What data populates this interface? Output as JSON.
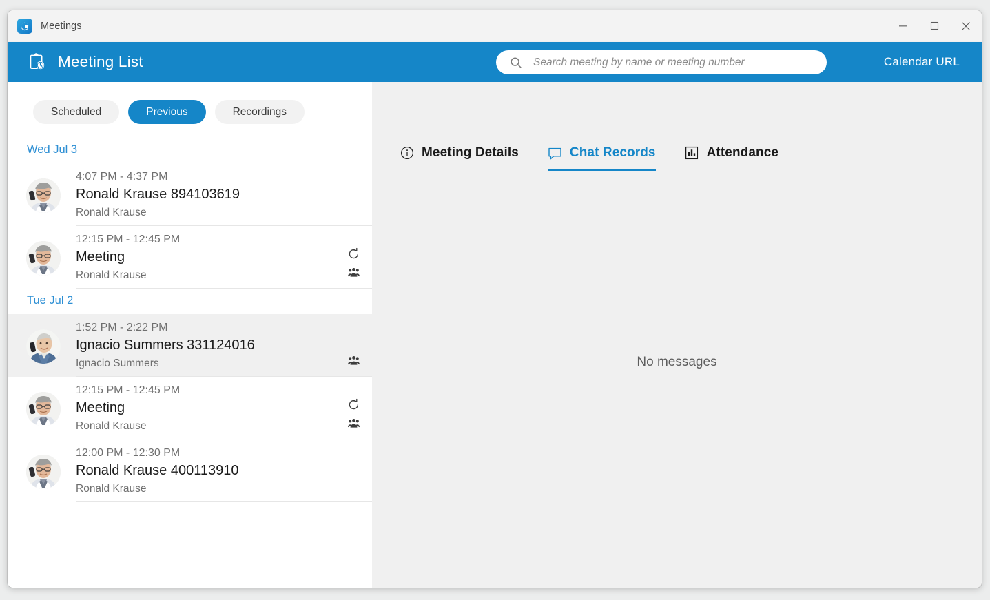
{
  "window": {
    "app_title": "Meetings",
    "logo_icon": "goto-g-logo-icon",
    "controls": {
      "minimize": "minimize-icon",
      "maximize": "maximize-icon",
      "close": "close-icon"
    }
  },
  "header": {
    "icon": "clipboard-clock-icon",
    "title": "Meeting List",
    "search": {
      "icon": "search-icon",
      "placeholder": "Search meeting by name or meeting number",
      "value": ""
    },
    "calendar_url_label": "Calendar URL",
    "background_color": "#1586c8"
  },
  "left_panel": {
    "filters": [
      {
        "label": "Scheduled",
        "active": false
      },
      {
        "label": "Previous",
        "active": true
      },
      {
        "label": "Recordings",
        "active": false
      }
    ],
    "groups": [
      {
        "day_label": "Wed Jul 3",
        "meetings": [
          {
            "time": "4:07 PM - 4:37 PM",
            "title": "Ronald Krause 894103619",
            "organizer": "Ronald Krause",
            "avatar": "man-on-phone-gray-hair",
            "selected": false,
            "recurring": false,
            "has_attendees": false
          },
          {
            "time": "12:15 PM - 12:45 PM",
            "title": "Meeting",
            "organizer": "Ronald Krause",
            "avatar": "man-on-phone-gray-hair",
            "selected": false,
            "recurring": true,
            "has_attendees": true
          }
        ]
      },
      {
        "day_label": "Tue Jul 2",
        "meetings": [
          {
            "time": "1:52 PM - 2:22 PM",
            "title": "Ignacio Summers 331124016",
            "organizer": "Ignacio Summers",
            "avatar": "older-man-on-phone",
            "selected": true,
            "recurring": false,
            "has_attendees": true
          },
          {
            "time": "12:15 PM - 12:45 PM",
            "title": "Meeting",
            "organizer": "Ronald Krause",
            "avatar": "man-on-phone-gray-hair",
            "selected": false,
            "recurring": true,
            "has_attendees": true
          },
          {
            "time": "12:00 PM - 12:30 PM",
            "title": "Ronald Krause 400113910",
            "organizer": "Ronald Krause",
            "avatar": "man-on-phone-gray-hair",
            "selected": false,
            "recurring": false,
            "has_attendees": false
          }
        ]
      }
    ]
  },
  "right_panel": {
    "tabs": [
      {
        "label": "Meeting Details",
        "icon": "info-circle-icon",
        "active": false
      },
      {
        "label": "Chat Records",
        "icon": "chat-bubble-icon",
        "active": true
      },
      {
        "label": "Attendance",
        "icon": "bar-chart-icon",
        "active": false
      }
    ],
    "empty_message": "No messages",
    "background_color": "#f0f0f0"
  },
  "colors": {
    "accent": "#1586c8",
    "day_header": "#2d8fd4",
    "selected_row": "#f0f0f0",
    "pill_inactive": "#f2f2f2"
  }
}
